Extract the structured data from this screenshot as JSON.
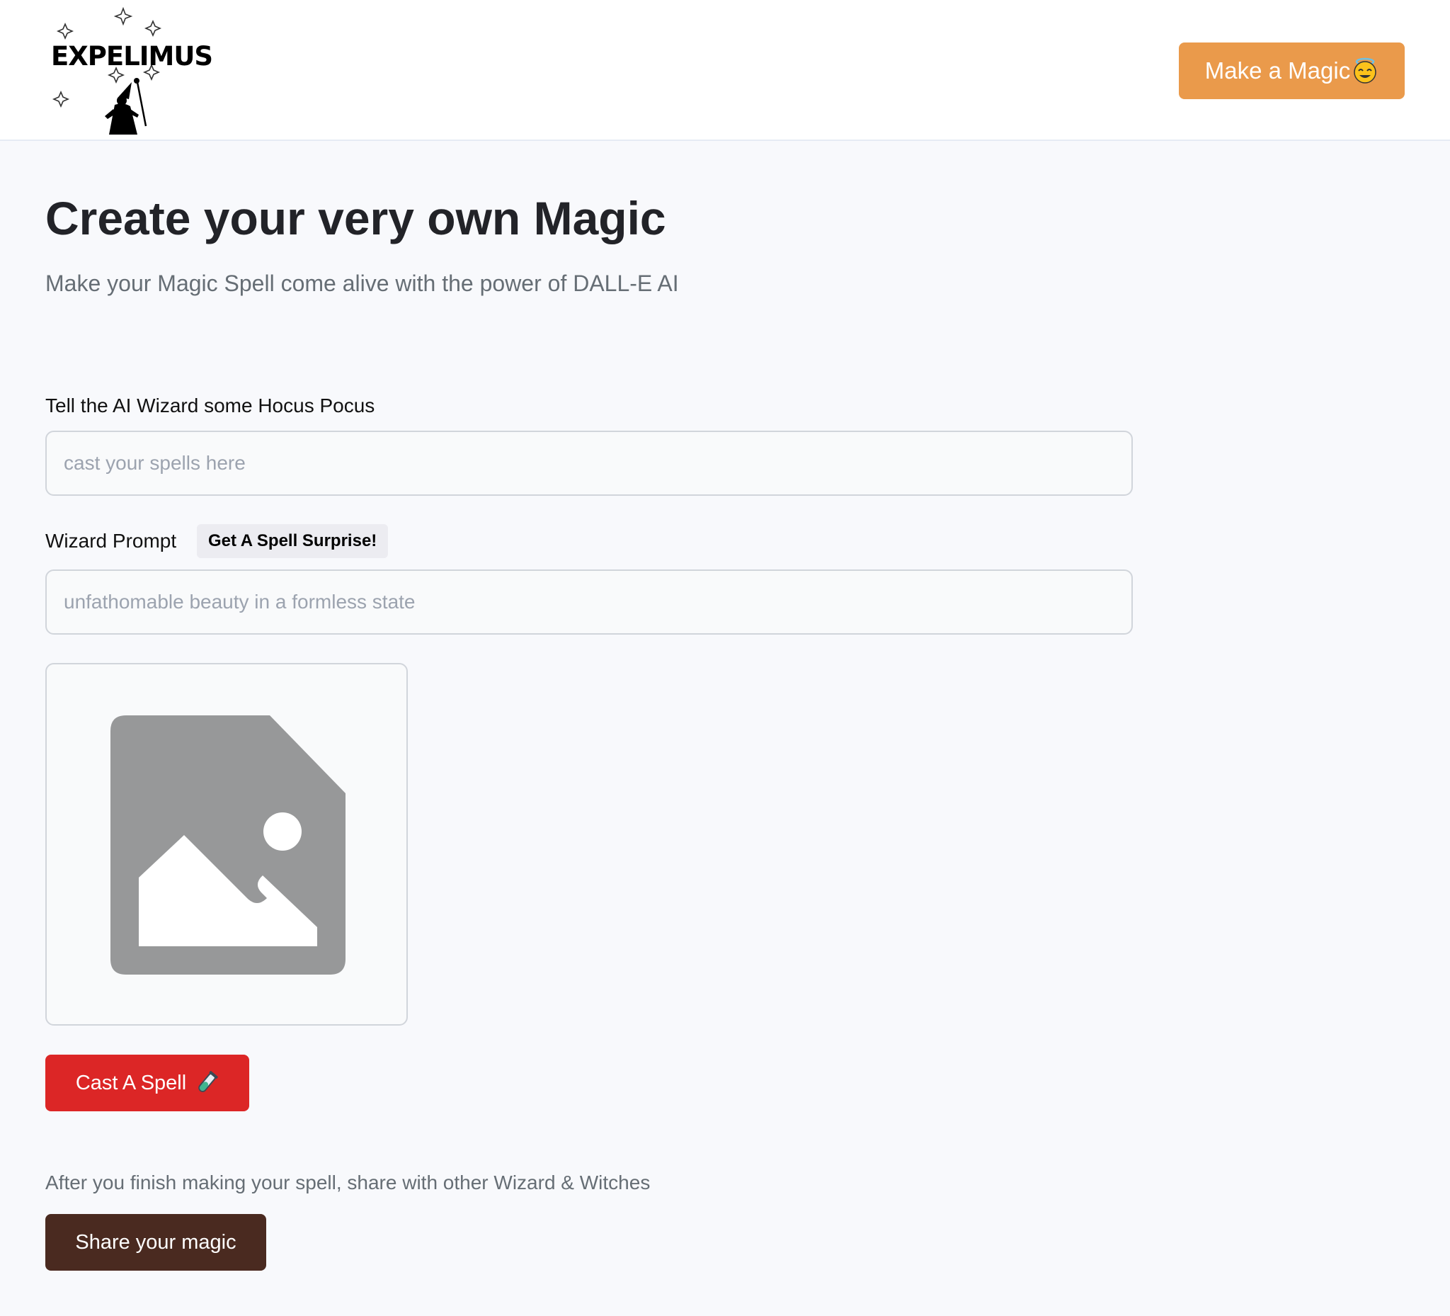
{
  "header": {
    "logo_text": "EXPELIMUS",
    "make_button_label": "Make a Magic",
    "make_button_emoji": "smiling-face-with-halo-icon",
    "accent_color": "#ea9a4b"
  },
  "hero": {
    "title": "Create your very own Magic",
    "subtitle": "Make your Magic Spell come alive with the power of DALL-E AI"
  },
  "form": {
    "name_label": "Tell the AI Wizard some Hocus Pocus",
    "name_placeholder": "cast your spells here",
    "name_value": "",
    "prompt_label": "Wizard Prompt",
    "surprise_button": "Get A Spell Surprise!",
    "prompt_placeholder": "unfathomable beauty in a formless state",
    "prompt_value": "",
    "preview_icon": "image-placeholder-icon"
  },
  "actions": {
    "cast_label": "Cast A Spell",
    "cast_icon": "test-tube-icon",
    "cast_color": "#dc2626",
    "share_note": "After you finish making your spell, share with other Wizard & Witches",
    "share_label": "Share your magic",
    "share_color": "#4a2a20"
  }
}
